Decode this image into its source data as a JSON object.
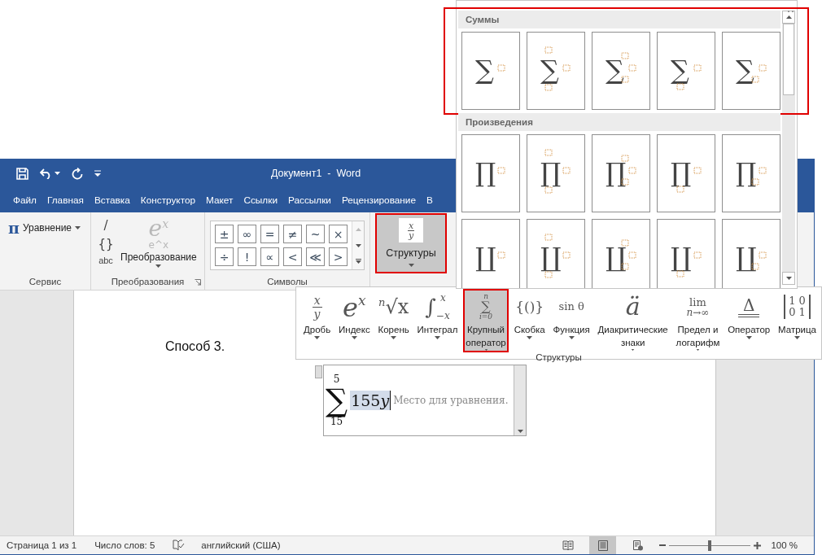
{
  "window": {
    "title": "Документ1  -  Word"
  },
  "tabs": [
    {
      "label": "Файл"
    },
    {
      "label": "Главная"
    },
    {
      "label": "Вставка"
    },
    {
      "label": "Конструктор"
    },
    {
      "label": "Макет"
    },
    {
      "label": "Ссылки"
    },
    {
      "label": "Рассылки"
    },
    {
      "label": "Рецензирование"
    },
    {
      "label": "В"
    }
  ],
  "ribbon": {
    "service": {
      "label": "Сервис",
      "equation": {
        "glyph": "π",
        "label": "Уравнение"
      }
    },
    "transform": {
      "label": "Преобразования",
      "small": [
        "/",
        "{}",
        "abc"
      ],
      "big": {
        "glyph": [
          "e",
          "x",
          "e^x"
        ],
        "label": "Преобразование",
        "disabled": true
      }
    },
    "symbols": {
      "label": "Символы",
      "items": [
        "±",
        "∞",
        "=",
        "≠",
        "~",
        "×",
        "÷",
        "!",
        "∝",
        "<",
        "≪",
        ">"
      ]
    },
    "structures": {
      "glyph": [
        "x",
        "y"
      ],
      "label": "Структуры",
      "pressed": true,
      "highlighted": true
    }
  },
  "document": {
    "text": "Способ 3.",
    "equation": {
      "upper": "5",
      "operator": "∑",
      "lower": "15",
      "number": "155",
      "variable": "y",
      "body_selected": true,
      "placeholder": "Место для уравнения."
    }
  },
  "structures_panel": {
    "title": "Структуры",
    "items": [
      {
        "kind": "fraction",
        "glyph": [
          "x",
          "y"
        ],
        "label": [
          "Дробь"
        ],
        "selected": false,
        "highlighted": false
      },
      {
        "kind": "script",
        "glyph": [
          "e",
          "x"
        ],
        "label": [
          "Индекс"
        ],
        "selected": false,
        "highlighted": false
      },
      {
        "kind": "radical",
        "glyph": [
          "n",
          "√x"
        ],
        "label": [
          "Корень"
        ],
        "selected": false,
        "highlighted": false
      },
      {
        "kind": "integral",
        "glyph": [
          "∫",
          "x",
          "−x"
        ],
        "label": [
          "Интеграл"
        ],
        "selected": false,
        "highlighted": false
      },
      {
        "kind": "large-operator",
        "glyph": [
          "n",
          "∑",
          "i=0"
        ],
        "label": [
          "Крупный",
          "оператор"
        ],
        "selected": true,
        "highlighted": true
      },
      {
        "kind": "bracket",
        "glyph": [
          "{()}"
        ],
        "label": [
          "Скобка"
        ],
        "selected": false,
        "highlighted": false
      },
      {
        "kind": "function",
        "glyph": [
          "sin θ"
        ],
        "label": [
          "Функция"
        ],
        "selected": false,
        "highlighted": false
      },
      {
        "kind": "accent",
        "glyph": [
          "ä"
        ],
        "label": [
          "Диакритические",
          "знаки"
        ],
        "selected": false,
        "highlighted": false
      },
      {
        "kind": "limit",
        "glyph": [
          "lim",
          "n→∞"
        ],
        "label": [
          "Предел и",
          "логарифм"
        ],
        "selected": false,
        "highlighted": false
      },
      {
        "kind": "operator",
        "glyph": [
          "Δ"
        ],
        "label": [
          "Оператор"
        ],
        "selected": false,
        "highlighted": false
      },
      {
        "kind": "matrix",
        "glyph": [
          "1",
          "0",
          "0",
          "1"
        ],
        "label": [
          "Матрица"
        ],
        "selected": false,
        "highlighted": false
      }
    ]
  },
  "gallery": {
    "sections": [
      {
        "title": "Суммы",
        "symbol": "∑",
        "highlighted": true,
        "tiles": [
          {
            "kind": "plain"
          },
          {
            "kind": "over-under"
          },
          {
            "kind": "sup-sub"
          },
          {
            "kind": "under"
          },
          {
            "kind": "sub"
          }
        ]
      },
      {
        "title": "Произведения",
        "symbol": "∏",
        "highlighted": false,
        "tiles": [
          {
            "kind": "plain"
          },
          {
            "kind": "over-under"
          },
          {
            "kind": "sup-sub"
          },
          {
            "kind": "under"
          },
          {
            "kind": "sub"
          }
        ]
      },
      {
        "symbol": "∐",
        "highlighted": false,
        "tiles": [
          {
            "kind": "plain"
          },
          {
            "kind": "over-under"
          },
          {
            "kind": "sup-sub"
          },
          {
            "kind": "under"
          },
          {
            "kind": "sub"
          }
        ]
      }
    ]
  },
  "status_bar": {
    "page": "Страница 1 из 1",
    "words": "Число слов: 5",
    "language": "английский (США)",
    "views": [
      {
        "kind": "read",
        "selected": false
      },
      {
        "kind": "print",
        "selected": true
      },
      {
        "kind": "web",
        "selected": false
      }
    ],
    "zoom": {
      "level": 0.5,
      "reading": "100 %"
    }
  }
}
